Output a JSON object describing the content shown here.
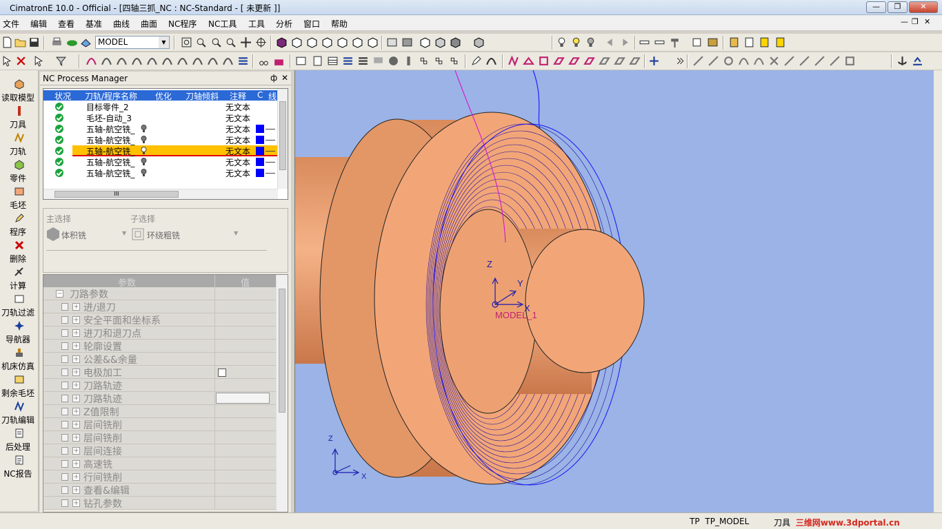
{
  "window": {
    "title": "CimatronE 10.0 - Official - [四轴三抓_NC : NC-Standard - [ 未更新 ]]"
  },
  "menu": [
    "文件",
    "编辑",
    "查看",
    "基准",
    "曲线",
    "曲面",
    "NC程序",
    "NC工具",
    "工具",
    "分析",
    "窗口",
    "帮助"
  ],
  "toolbar": {
    "model_combo": "MODEL"
  },
  "left_toolbar": [
    "读取模型",
    "刀具",
    "刀轨",
    "零件",
    "毛坯",
    "程序",
    "删除",
    "计算",
    "刀轨过滤",
    "导航器",
    "机床仿真",
    "剩余毛坯",
    "刀轨编辑",
    "后处理",
    "NC报告"
  ],
  "nc_manager": {
    "title": "NC Process Manager",
    "pin": "ф",
    "close": "✕",
    "columns": [
      "状况",
      "刀轨/程序名称",
      "优化",
      "刀轴倾斜",
      "注释",
      "C",
      "线"
    ],
    "rows": [
      {
        "name": "目标零件_2",
        "note": "无文本",
        "bulb": false,
        "highlight": false
      },
      {
        "name": "毛坯-自动_3",
        "note": "无文本",
        "bulb": false,
        "highlight": false
      },
      {
        "name": "五轴-航空铣_",
        "note": "无文本",
        "bulb": true,
        "highlight": false
      },
      {
        "name": "五轴-航空铣_",
        "note": "无文本",
        "bulb": true,
        "highlight": false
      },
      {
        "name": "五轴-航空铣_",
        "note": "无文本",
        "bulb": true,
        "highlight": true
      },
      {
        "name": "五轴-航空铣_",
        "note": "无文本",
        "bulb": true,
        "highlight": false
      },
      {
        "name": "五轴-航空铣_",
        "note": "无文本",
        "bulb": true,
        "highlight": false
      }
    ],
    "hscroll_label": "III"
  },
  "selection": {
    "main_label": "主选择",
    "main_value": "体积铣",
    "sub_label": "子选择",
    "sub_value": "环绕粗铣"
  },
  "params": {
    "col_param": "参数",
    "col_value": "值",
    "rows": [
      {
        "label": "刀路参数",
        "level": 0
      },
      {
        "label": "进/退刀",
        "level": 1
      },
      {
        "label": "安全平面和坐标系",
        "level": 1
      },
      {
        "label": "进刀和退刀点",
        "level": 1
      },
      {
        "label": "轮廓设置",
        "level": 1
      },
      {
        "label": "公差&&余量",
        "level": 1
      },
      {
        "label": "电极加工",
        "level": 1,
        "value": "checkbox"
      },
      {
        "label": "刀路轨迹",
        "level": 1
      },
      {
        "label": "刀路轨迹",
        "level": 1,
        "value": "field"
      },
      {
        "label": "Z值限制",
        "level": 1
      },
      {
        "label": "层间铣削",
        "level": 1
      },
      {
        "label": "层间铣削",
        "level": 1
      },
      {
        "label": "层间连接",
        "level": 1
      },
      {
        "label": "高速铣",
        "level": 1
      },
      {
        "label": "行间铣削",
        "level": 1
      },
      {
        "label": "查看&编辑",
        "level": 1
      },
      {
        "label": "钻孔参数",
        "level": 1
      }
    ]
  },
  "viewport": {
    "model_label": "MODEL_1",
    "axis_x": "X",
    "axis_y": "Y",
    "axis_z": "Z",
    "part_color": "#f2a678",
    "background": "#9bb3e6"
  },
  "status": {
    "tp": "TP",
    "tp_model": "TP_MODEL",
    "tool": "刀具",
    "watermark": "三维网www.3dportal.cn"
  }
}
